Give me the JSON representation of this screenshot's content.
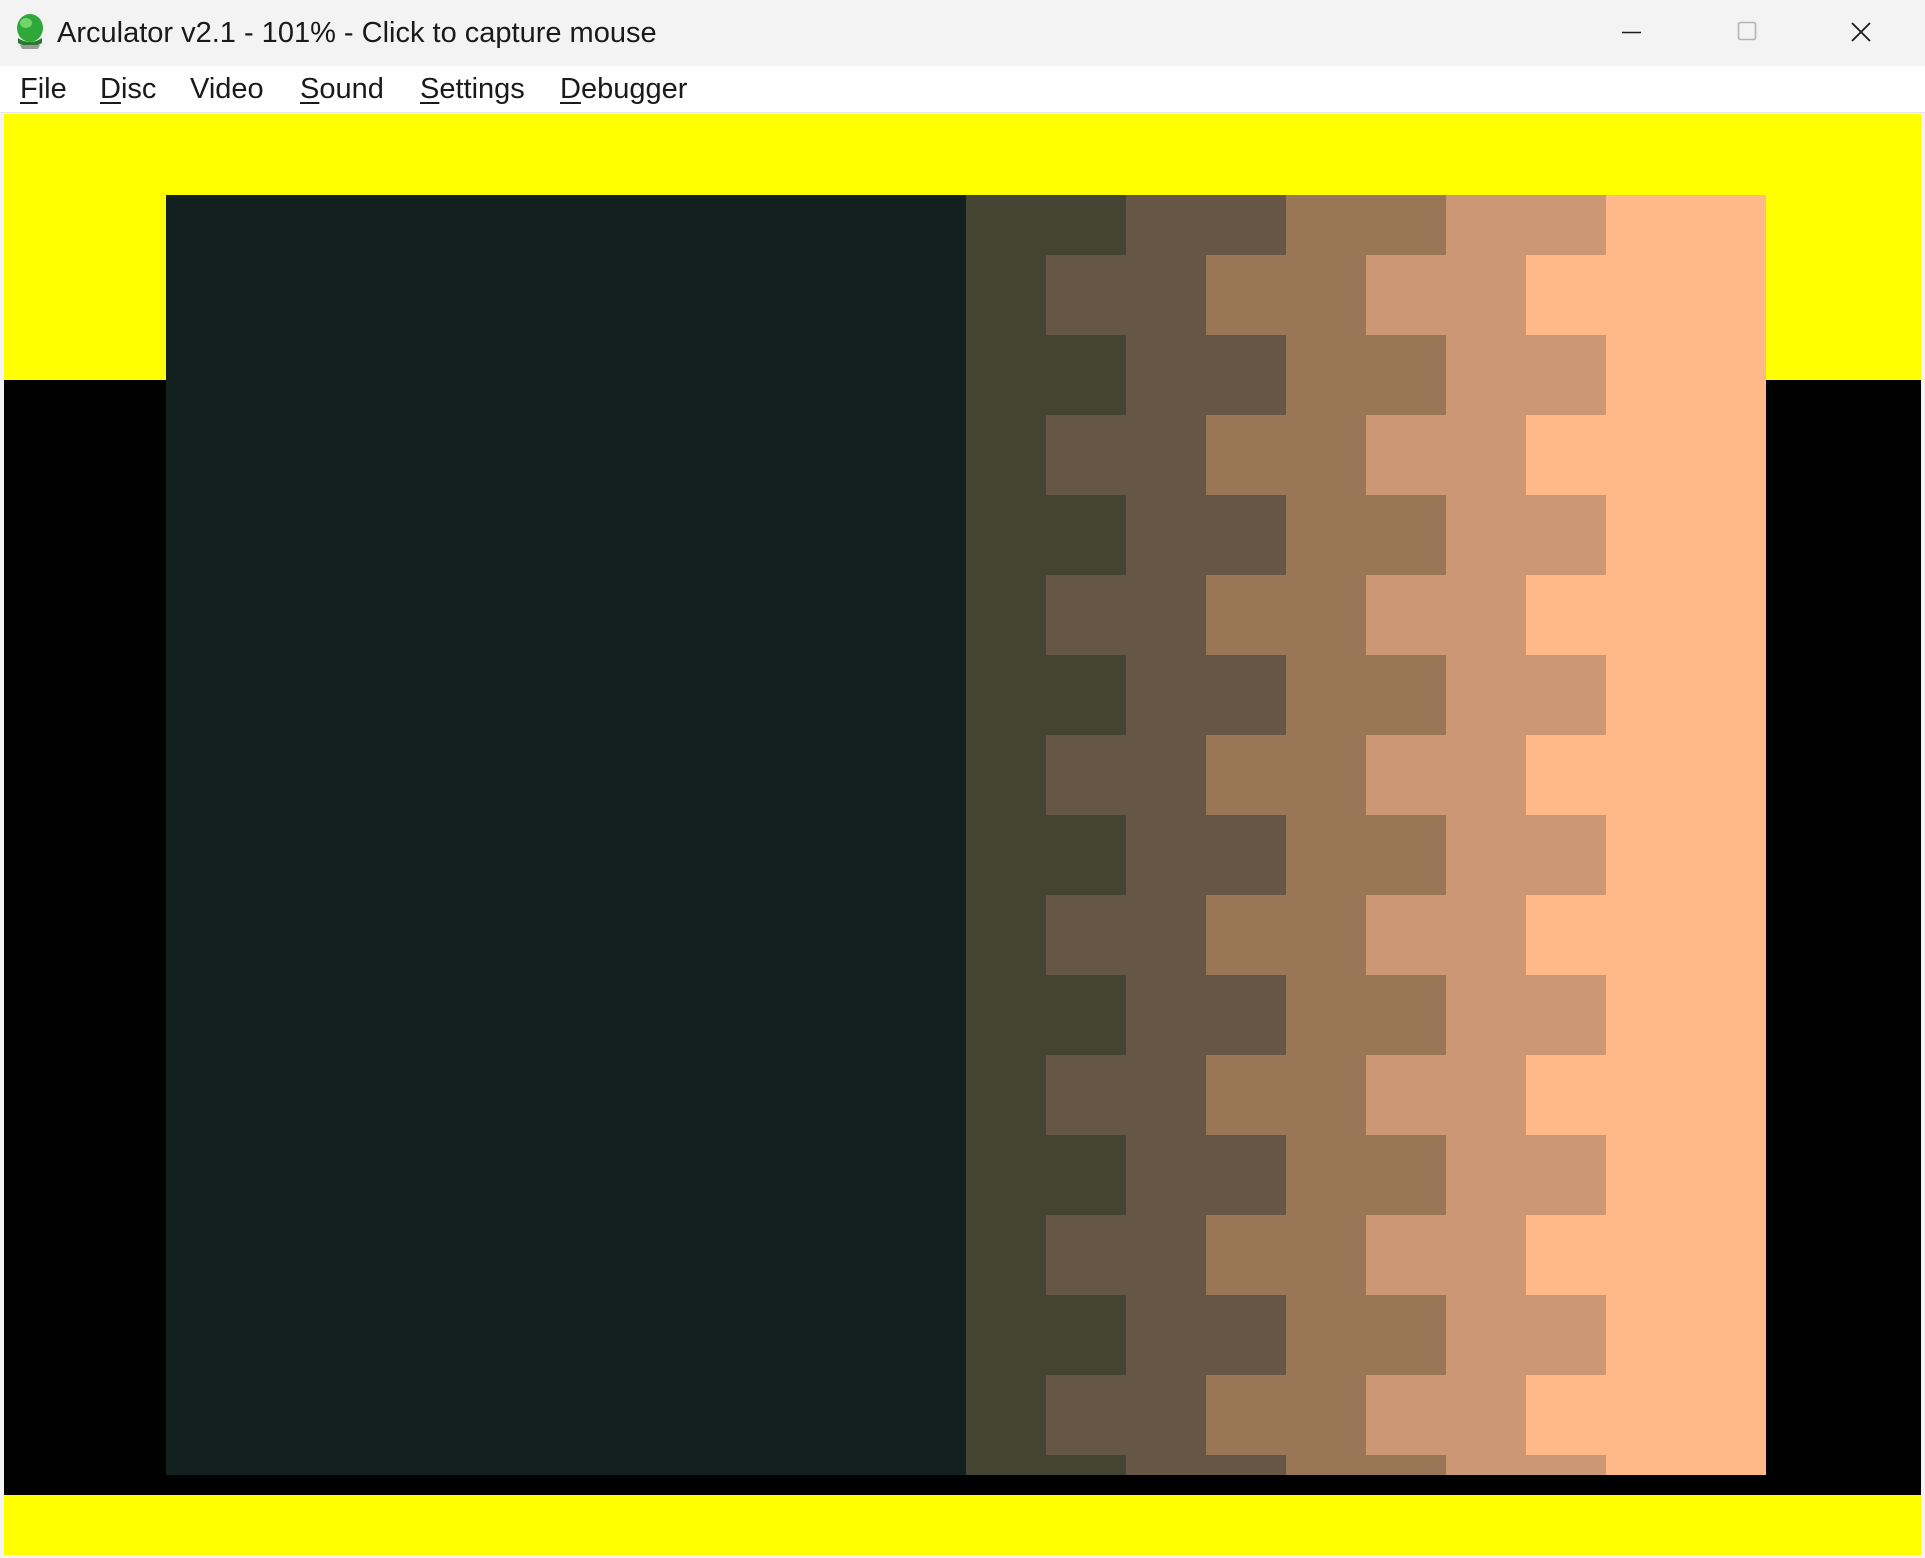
{
  "window": {
    "title": "Arculator v2.1 - 101% - Click to capture mouse",
    "icon": "arculator-app-icon",
    "controls": {
      "minimize": "minimize-icon",
      "maximize": "maximize-icon",
      "close": "close-icon"
    }
  },
  "menubar": {
    "items": [
      {
        "mnemonic": "F",
        "rest": "ile"
      },
      {
        "mnemonic": "D",
        "rest": "isc"
      },
      {
        "pre": "",
        "mnemonic": "",
        "rest": "Video"
      },
      {
        "mnemonic": "S",
        "rest": "ound"
      },
      {
        "mnemonic": "S",
        "rest": "ettings"
      },
      {
        "mnemonic": "D",
        "rest": "ebugger"
      }
    ]
  },
  "display": {
    "border_color": "#ffff00",
    "background_color": "#000000",
    "palette": [
      "#12201f",
      "#434431",
      "#665645",
      "#997655",
      "#cb9775",
      "#ffb887"
    ]
  }
}
